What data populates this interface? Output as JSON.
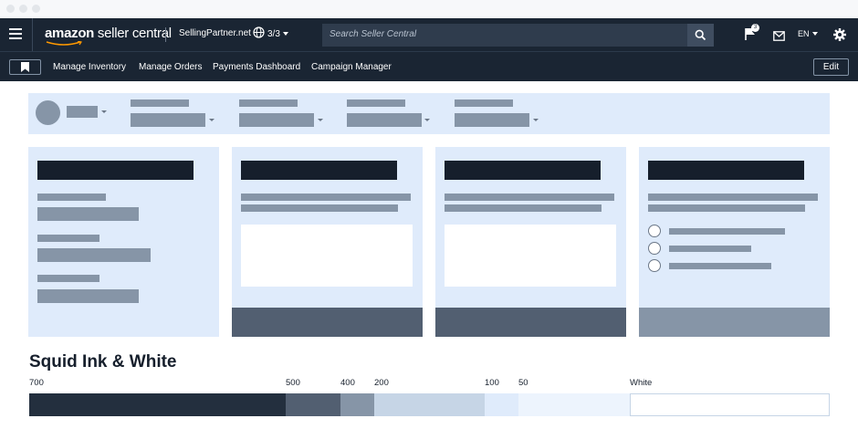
{
  "header": {
    "logo_brand": "amazon",
    "logo_product": " seller central",
    "account": "SellingPartner.net",
    "marketplace": "3/3",
    "search_placeholder": "Search Seller Central",
    "notification_count": "3",
    "language": "EN"
  },
  "nav": {
    "links": [
      "Manage Inventory",
      "Manage Orders",
      "Payments Dashboard",
      "Campaign Manager"
    ],
    "edit_label": "Edit"
  },
  "palette": {
    "title": "Squid Ink & White",
    "swatches": [
      {
        "label": "700",
        "color": "#232f3e"
      },
      {
        "label": "500",
        "color": "#525f71"
      },
      {
        "label": "400",
        "color": "#8695a7"
      },
      {
        "label": "200",
        "color": "#c6d5e6"
      },
      {
        "label": "100",
        "color": "#dfebfb"
      },
      {
        "label": "50",
        "color": "#edf4fd"
      },
      {
        "label": "White",
        "color": "#ffffff"
      }
    ]
  },
  "colors": {
    "squid_ink": "#1a2533",
    "placeholder_bar": "#8695a7",
    "card_background": "#dfebfb"
  },
  "icons": [
    "menu-icon",
    "globe-icon",
    "search-icon",
    "flag-icon",
    "mail-icon",
    "gear-icon",
    "bookmark-icon"
  ]
}
